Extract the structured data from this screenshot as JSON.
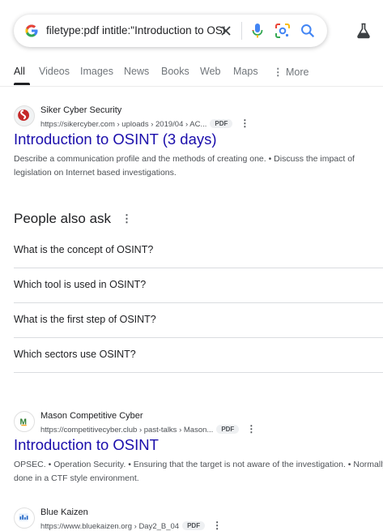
{
  "search": {
    "query": "filetype:pdf intitle:\"Introduction to OSINT\""
  },
  "tabs": [
    {
      "label": "All"
    },
    {
      "label": "Videos"
    },
    {
      "label": "Images"
    },
    {
      "label": "News"
    },
    {
      "label": "Books"
    },
    {
      "label": "Web"
    },
    {
      "label": "Maps"
    },
    {
      "label": "More"
    }
  ],
  "results": [
    {
      "site_name": "Siker Cyber Security",
      "url": "https://sikercyber.com › uploads › 2019/04 › AC...",
      "badge": "PDF",
      "title": "Introduction to OSINT (3 days)",
      "snippet": "Describe a communication profile and the methods of creating one. • Discuss the impact of legislation on Internet based investigations."
    },
    {
      "site_name": "Mason Competitive Cyber",
      "url": "https://competitivecyber.club › past-talks › Mason...",
      "badge": "PDF",
      "title": "Introduction to OSINT",
      "snippet": "OPSEC. • Operation Security. • Ensuring that the target is not aware of the investigation. • Normally done in a CTF style environment."
    },
    {
      "site_name": "Blue Kaizen",
      "url": "https://www.bluekaizen.org › Day2_B_04",
      "badge": "PDF"
    }
  ],
  "people_also_ask": {
    "heading": "People also ask",
    "questions": [
      "What is the concept of OSINT?",
      "Which tool is used in OSINT?",
      "What is the first step of OSINT?",
      "Which sectors use OSINT?"
    ]
  },
  "colors": {
    "link": "#1a0dab",
    "text": "#202124",
    "muted": "#4d5156",
    "google_blue": "#4285f4",
    "google_red": "#ea4335",
    "google_yellow": "#fbbc05",
    "google_green": "#34a853"
  },
  "icons": {
    "logo": "google-g-icon",
    "clear": "close-icon",
    "voice": "microphone-icon",
    "lens": "camera-lens-icon",
    "search": "search-icon",
    "labs": "flask-icon",
    "more": "kebab-icon"
  }
}
